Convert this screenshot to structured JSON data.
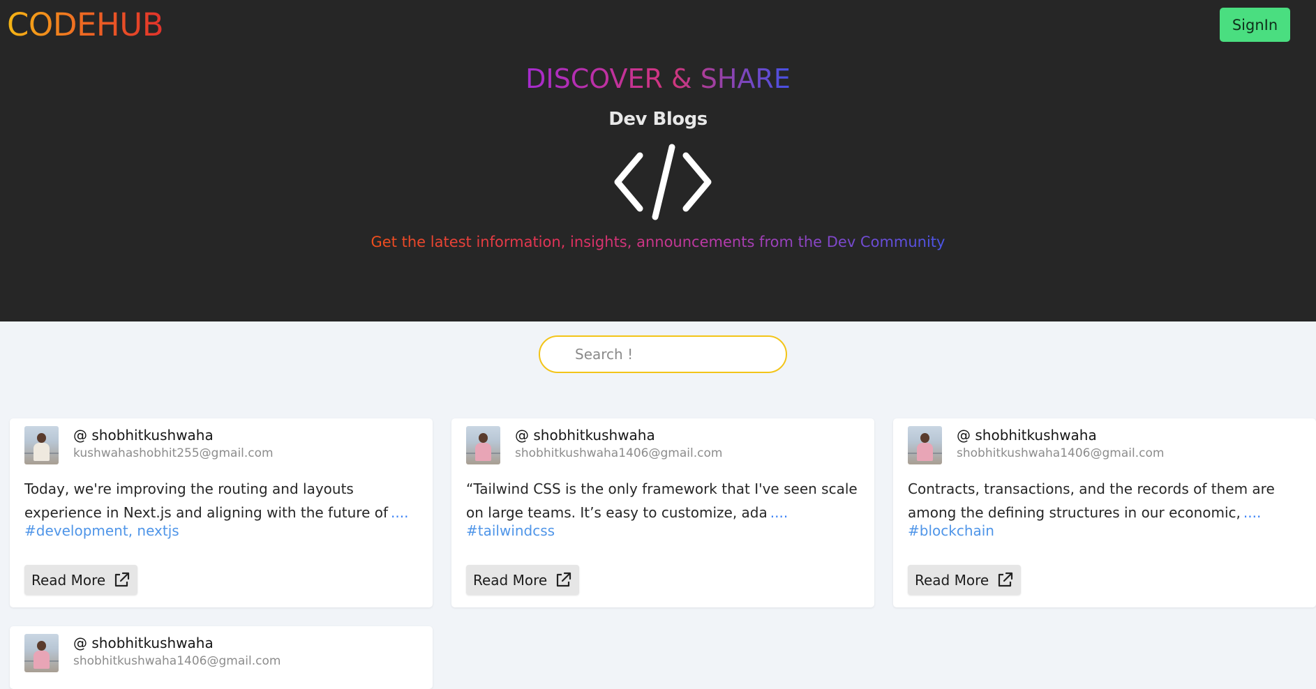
{
  "header": {
    "logo": "CODEHUB",
    "signin_label": "SignIn"
  },
  "hero": {
    "title": "DISCOVER & SHARE",
    "subtitle": "Dev Blogs",
    "icon": "code-icon",
    "tagline": "Get the latest information, insights, announcements from the Dev Community"
  },
  "search": {
    "placeholder": "Search !"
  },
  "posts": [
    {
      "username": "@ shobhitkushwaha",
      "email": "kushwahashobhit255@gmail.com",
      "excerpt": "Today, we're improving the routing and layouts experience in Next.js and aligning with the future of",
      "more": "....",
      "tags": "#development, nextjs",
      "read_more": "Read More"
    },
    {
      "username": "@ shobhitkushwaha",
      "email": "shobhitkushwaha1406@gmail.com",
      "excerpt": "“Tailwind CSS is the only framework that I've seen scale on large teams. It’s easy to customize, ada",
      "more": "....",
      "tags": "#tailwindcss",
      "read_more": "Read More"
    },
    {
      "username": "@ shobhitkushwaha",
      "email": "shobhitkushwaha1406@gmail.com",
      "excerpt": "Contracts, transactions, and the records of them are among the defining structures in our economic,",
      "more": "....",
      "tags": "#blockchain",
      "read_more": "Read More"
    },
    {
      "username": "@ shobhitkushwaha",
      "email": "shobhitkushwaha1406@gmail.com"
    }
  ],
  "colors": {
    "hero_bg": "#262626",
    "page_bg": "#f1f4f8",
    "signin_bg": "#4ade80",
    "search_border": "#f3c418",
    "tag_color": "#4f95e8"
  }
}
